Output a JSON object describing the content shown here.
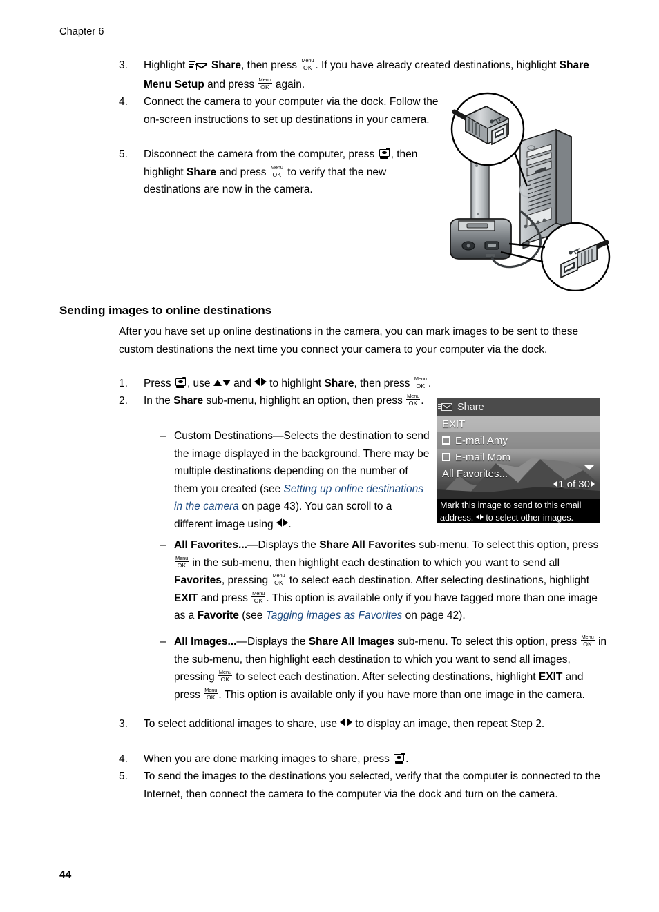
{
  "header": {
    "chapter": "Chapter 6"
  },
  "footer": {
    "page_number": "44"
  },
  "icons": {
    "menu_ok_top": "Menu",
    "menu_ok_bottom": "OK",
    "share_icon": "share-envelope-icon",
    "camera_icon": "camera-playback-icon"
  },
  "top_steps": [
    {
      "number": "3.",
      "parts": {
        "t1": "Highlight ",
        "b1": "Share",
        "t2": ", then press ",
        "t3": ". If you have already created destinations, highlight ",
        "b2": "Share Menu Setup",
        "t4": " and press ",
        "t5": " again."
      }
    },
    {
      "number": "4.",
      "parts": {
        "t1": "Connect the camera to your computer via the dock. Follow the on-screen instructions to set up destinations in your camera."
      }
    },
    {
      "number": "5.",
      "parts": {
        "t1": "Disconnect the camera from the computer, press ",
        "t2": ", then highlight ",
        "b1": "Share",
        "t3": " and press ",
        "t4": " to verify that the new destinations are now in the camera."
      }
    }
  ],
  "section": {
    "heading": "Sending images to online destinations",
    "intro": "After you have set up online destinations in the camera, you can mark images to be sent to these custom destinations the next time you connect your camera to your computer via the dock."
  },
  "main_steps": {
    "step1": {
      "number": "1.",
      "t1": "Press ",
      "t2": ", use ",
      "t3": " and ",
      "t4": " to highlight ",
      "b1": "Share",
      "t5": ", then press ",
      "t6": "."
    },
    "step2": {
      "number": "2.",
      "t1": "In the ",
      "b1": "Share",
      "t2": " sub-menu, highlight an option, then press ",
      "t3": "."
    },
    "step3": {
      "number": "3.",
      "t1": "To select additional images to share, use ",
      "t2": " to display an image, then repeat Step 2."
    },
    "step4": {
      "number": "4.",
      "t1": "When you are done marking images to share, press ",
      "t2": "."
    },
    "step5": {
      "number": "5.",
      "t1": "To send the images to the destinations you selected, verify that the computer is connected to the Internet, then connect the camera to the computer via the dock and turn on the camera."
    }
  },
  "sub_options": {
    "custom_destinations": {
      "dash": "–",
      "t1": "Custom Destinations—Selects the destination to send the image displayed in the background. There may be multiple destinations depending on the number of them you created (see ",
      "link1": "Setting up online destinations in the camera",
      "t2": " on page 43",
      "t3": "). You can scroll to a different image using ",
      "t4": "."
    },
    "all_favorites": {
      "dash": "–",
      "b1": "All Favorites...",
      "t1": "—Displays the ",
      "b2": "Share All Favorites",
      "t2": " sub-menu. To select this option, press ",
      "t3": " in the sub-menu, then highlight each destination to which you want to send all ",
      "b3": "Favorites",
      "t4": ", pressing ",
      "t5": " to select each destination. After selecting destinations, highlight ",
      "b4": "EXIT",
      "t6": " and press ",
      "t7": ". This option is available only if you have tagged more than one image as a ",
      "b5": "Favorite",
      "t8": " (see ",
      "link1": "Tagging images as Favorites",
      "t9": " on page 42",
      "t10": ")."
    },
    "all_images": {
      "dash": "–",
      "b1": "All Images...",
      "t1": "—Displays the ",
      "b2": "Share All Images",
      "t2": " sub-menu. To select this option, press ",
      "t3": " in the sub-menu, then highlight each destination to which you want to send all images, pressing ",
      "t4": " to select each destination. After selecting destinations, highlight ",
      "b3": "EXIT",
      "t5": " and press ",
      "t6": ". This option is available only if you have more than one image in the camera."
    }
  },
  "camera_screen": {
    "title": "Share",
    "menu_items": [
      {
        "label": "EXIT",
        "checkbox": false,
        "selected": false
      },
      {
        "label": "E-mail Amy",
        "checkbox": true,
        "selected": true
      },
      {
        "label": "E-mail Mom",
        "checkbox": true,
        "selected": false
      },
      {
        "label": "All Favorites...",
        "checkbox": false,
        "selected": false
      }
    ],
    "counter": "1 of 30",
    "help_line1": "Mark this image to send to this email",
    "help_line2a": "address.",
    "help_line2b": "to select other images."
  },
  "illustration": {
    "name": "camera-dock-usb-computer-diagram",
    "callout_top": "usb-connector-a-closeup",
    "callout_bottom": "usb-connector-b-closeup",
    "objects": [
      "camera-in-dock",
      "desktop-computer-tower",
      "usb-cable"
    ]
  },
  "colors": {
    "link": "#1c4a80",
    "lcd_titlebar": "#4b4b4b",
    "lcd_help_bar": "#000000",
    "text": "#000000"
  }
}
